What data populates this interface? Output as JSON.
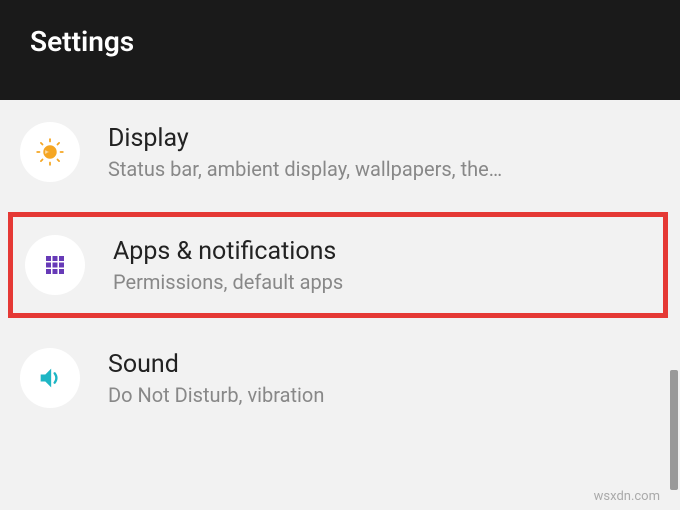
{
  "header": {
    "title": "Settings"
  },
  "items": [
    {
      "title": "Display",
      "subtitle": "Status bar, ambient display, wallpapers, the…",
      "icon": "display-brightness-icon",
      "highlighted": false
    },
    {
      "title": "Apps & notifications",
      "subtitle": "Permissions, default apps",
      "icon": "apps-grid-icon",
      "highlighted": true
    },
    {
      "title": "Sound",
      "subtitle": "Do Not Disturb, vibration",
      "icon": "sound-speaker-icon",
      "highlighted": false
    }
  ],
  "colors": {
    "highlight_border": "#e53935",
    "icon_display": "#f5a623",
    "icon_apps": "#673ab7",
    "icon_sound": "#1eb6c4"
  },
  "watermark": "wsxdn.com"
}
